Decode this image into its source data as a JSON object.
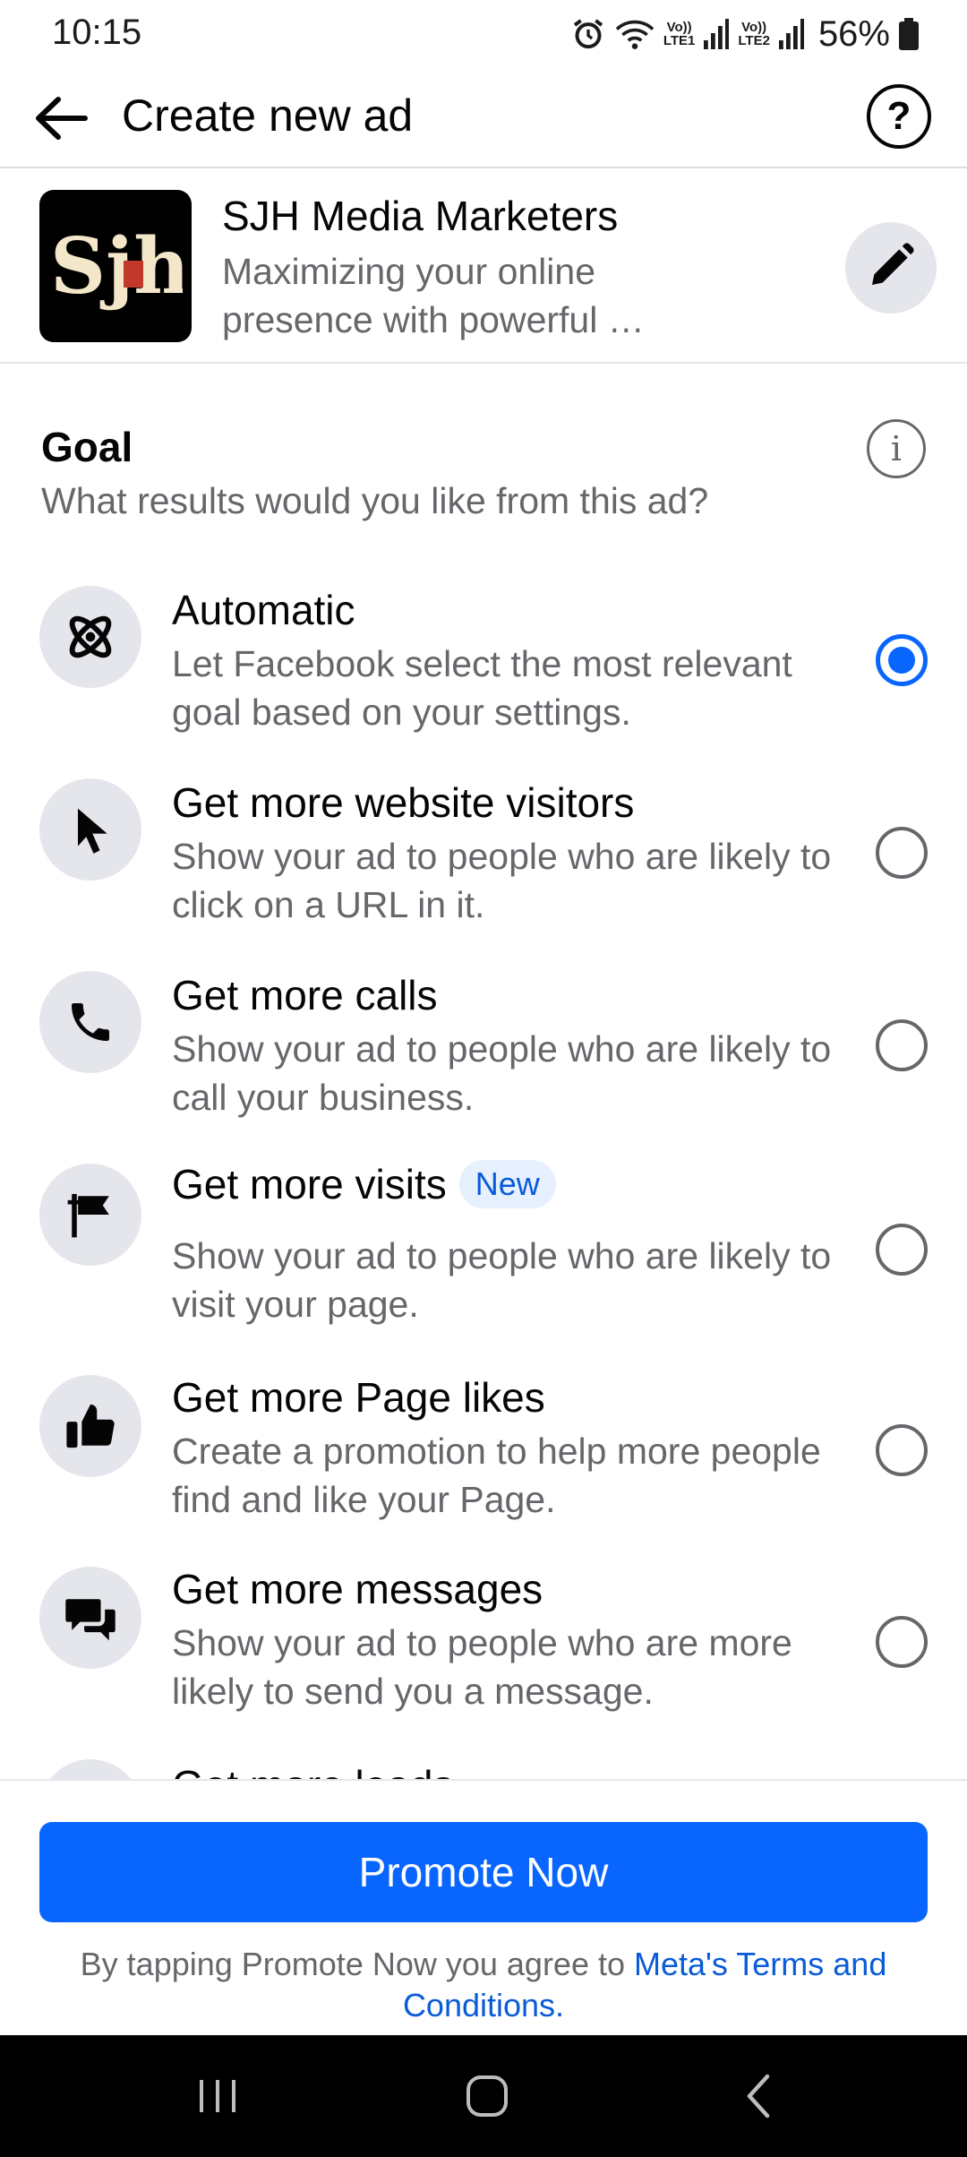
{
  "status_bar": {
    "time": "10:15",
    "net1_top": "Vo))",
    "net1_bottom": "LTE1",
    "net2_top": "Vo))",
    "net2_bottom": "LTE2",
    "battery": "56%"
  },
  "header": {
    "title": "Create new ad"
  },
  "page": {
    "logo_text": "Sjh",
    "name": "SJH Media Marketers",
    "description": "Maximizing your online presence with powerful …"
  },
  "goal": {
    "title": "Goal",
    "subtitle": "What results would you like from this ad?",
    "options": [
      {
        "title": "Automatic",
        "description": "Let Facebook select the most relevant goal based on your settings.",
        "icon": "atom-icon",
        "selected": true
      },
      {
        "title": "Get more website visitors",
        "description": "Show your ad to people who are likely to click on a URL in it.",
        "icon": "cursor-icon",
        "selected": false
      },
      {
        "title": "Get more calls",
        "description": "Show your ad to people who are likely to call your business.",
        "icon": "phone-icon",
        "selected": false
      },
      {
        "title": "Get more visits",
        "badge": "New",
        "description": "Show your ad to people who are likely to visit your page.",
        "icon": "storefront-flag-icon",
        "selected": false
      },
      {
        "title": "Get more Page likes",
        "description": "Create a promotion to help more people find and like your Page.",
        "icon": "thumbs-up-icon",
        "selected": false
      },
      {
        "title": "Get more messages",
        "description": "Show your ad to people who are more likely to send you a message.",
        "icon": "chat-bubbles-icon",
        "selected": false
      },
      {
        "title": "Get more leads",
        "icon": "leads-icon",
        "selected": false
      }
    ]
  },
  "footer": {
    "button_label": "Promote Now",
    "terms_prefix": "By tapping Promote Now you agree to ",
    "terms_link": "Meta's Terms and Conditions",
    "terms_suffix": "."
  },
  "colors": {
    "accent": "#0866ff",
    "link": "#0a5bd8",
    "secondary_text": "#65676b",
    "icon_bg": "#e4e6eb"
  }
}
